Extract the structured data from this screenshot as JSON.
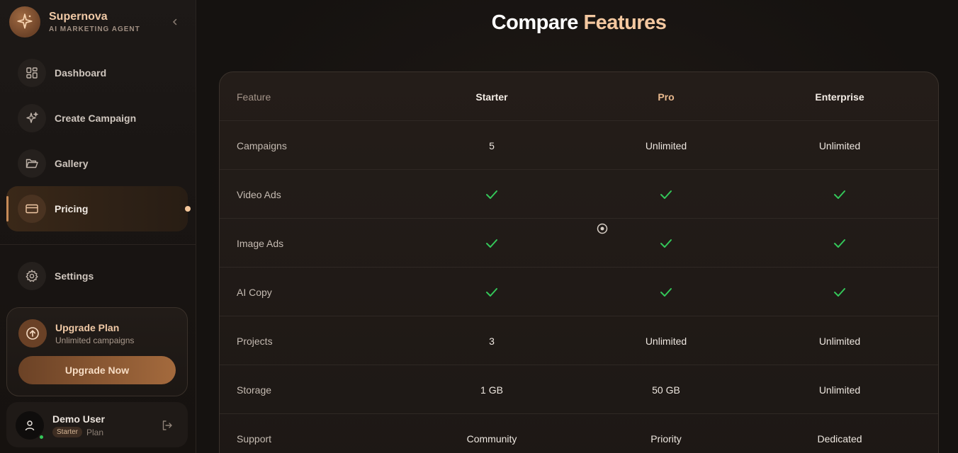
{
  "brand": {
    "name": "Supernova",
    "subtitle": "AI MARKETING AGENT"
  },
  "nav": [
    {
      "label": "Dashboard",
      "icon": "grid-icon"
    },
    {
      "label": "Create Campaign",
      "icon": "sparkles-icon"
    },
    {
      "label": "Gallery",
      "icon": "folder-icon"
    },
    {
      "label": "Pricing",
      "icon": "credit-card-icon",
      "active": true
    },
    {
      "label": "Settings",
      "icon": "gear-icon"
    }
  ],
  "upgrade": {
    "title": "Upgrade Plan",
    "subtitle": "Unlimited campaigns",
    "button": "Upgrade Now"
  },
  "user": {
    "name": "Demo User",
    "plan_badge": "Starter",
    "plan_label": "Plan"
  },
  "page": {
    "title_main": "Compare ",
    "title_accent": "Features"
  },
  "table": {
    "headers": [
      "Feature",
      "Starter",
      "Pro",
      "Enterprise"
    ],
    "rows": [
      [
        "Campaigns",
        "5",
        "Unlimited",
        "Unlimited"
      ],
      [
        "Video Ads",
        "check",
        "check",
        "check"
      ],
      [
        "Image Ads",
        "check",
        "check",
        "check"
      ],
      [
        "AI Copy",
        "check",
        "check",
        "check"
      ],
      [
        "Projects",
        "3",
        "Unlimited",
        "Unlimited"
      ],
      [
        "Storage",
        "1 GB",
        "50 GB",
        "Unlimited"
      ],
      [
        "Support",
        "Community",
        "Priority",
        "Dedicated"
      ]
    ]
  },
  "colors": {
    "accent": "#f4c8a0",
    "check": "#34c759",
    "online": "#34c759"
  }
}
